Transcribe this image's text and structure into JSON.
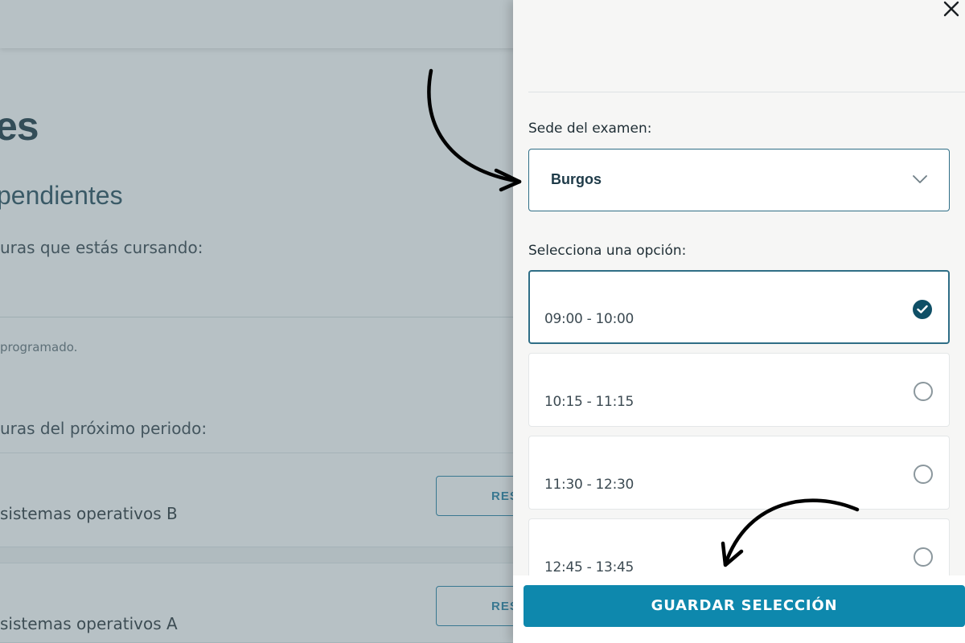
{
  "background": {
    "title": "es",
    "subtitle": "pendientes",
    "current_label": "uras que estás cursando:",
    "none_scheduled": "programado.",
    "next_label": "uras del próximo periodo:",
    "rows": [
      {
        "name": "sistemas operativos B",
        "button": "RES"
      },
      {
        "name": "sistemas operativos A",
        "button": "RES"
      }
    ]
  },
  "drawer": {
    "close_icon": "close-icon",
    "sede_label": "Sede del examen:",
    "sede_value": "Burgos",
    "option_label": "Selecciona una opción:",
    "options": [
      {
        "time": "09:00 - 10:00",
        "selected": true
      },
      {
        "time": "10:15 - 11:15",
        "selected": false
      },
      {
        "time": "11:30 - 12:30",
        "selected": false
      },
      {
        "time": "12:45 - 13:45",
        "selected": false
      }
    ],
    "save_label": "GUARDAR SELECCIÓN"
  },
  "colors": {
    "accent": "#0e88ad",
    "selected_border": "#2f6e86",
    "check_fill": "#0f4f66"
  }
}
